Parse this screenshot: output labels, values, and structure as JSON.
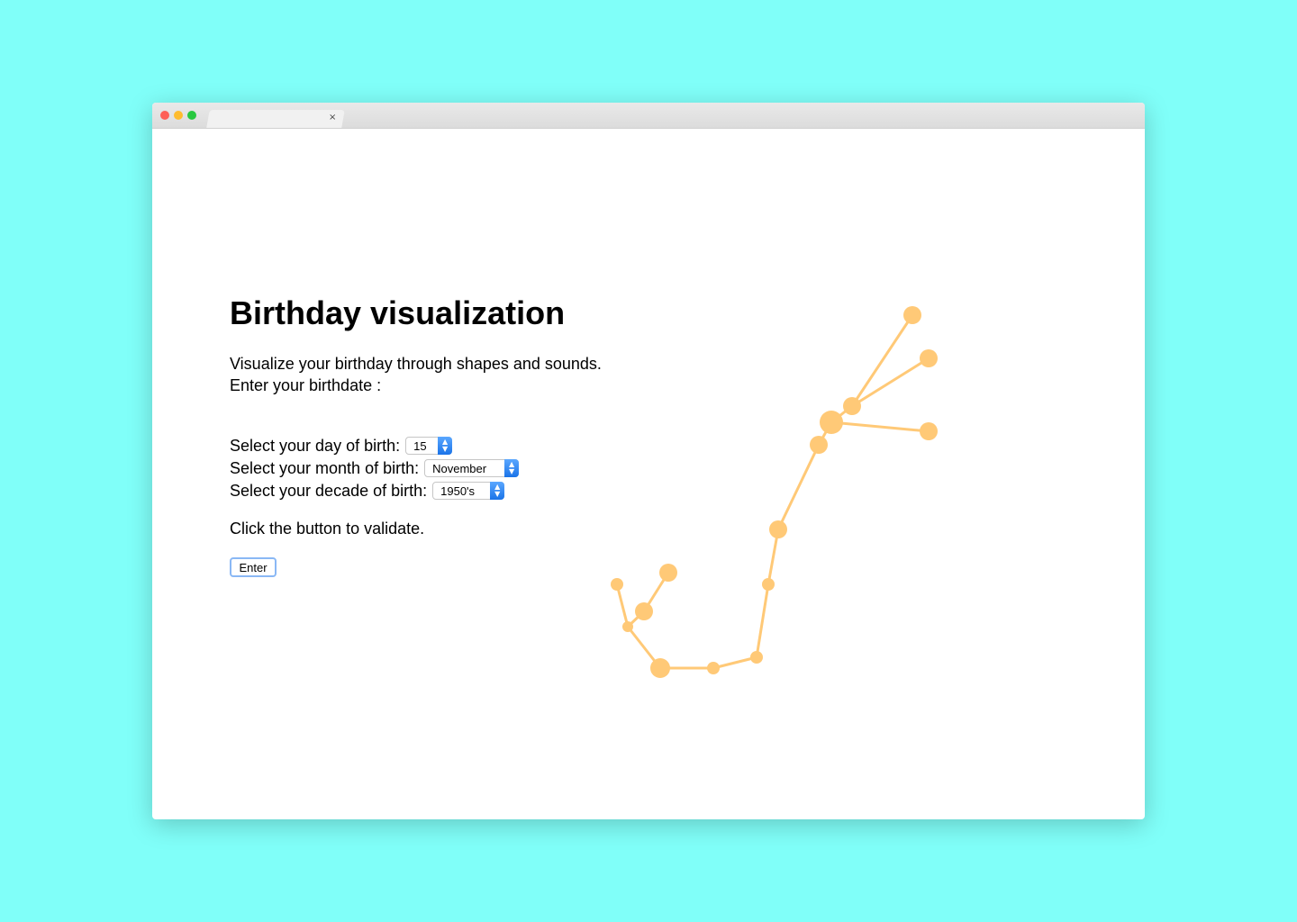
{
  "window": {
    "tab_close_glyph": "×"
  },
  "page": {
    "title": "Birthday visualization",
    "intro_line_1": "Visualize your birthday through shapes and sounds.",
    "intro_line_2": "Enter your birthdate :",
    "validate_text": "Click the button to validate."
  },
  "form": {
    "day": {
      "label": "Select your day of birth:",
      "value": "15"
    },
    "month": {
      "label": "Select your month of birth:",
      "value": "November"
    },
    "decade": {
      "label": "Select your decade of birth:",
      "value": "1950's"
    },
    "enter_label": "Enter"
  },
  "visualization": {
    "color": "#ffc977",
    "icon": "scorpio-constellation"
  }
}
